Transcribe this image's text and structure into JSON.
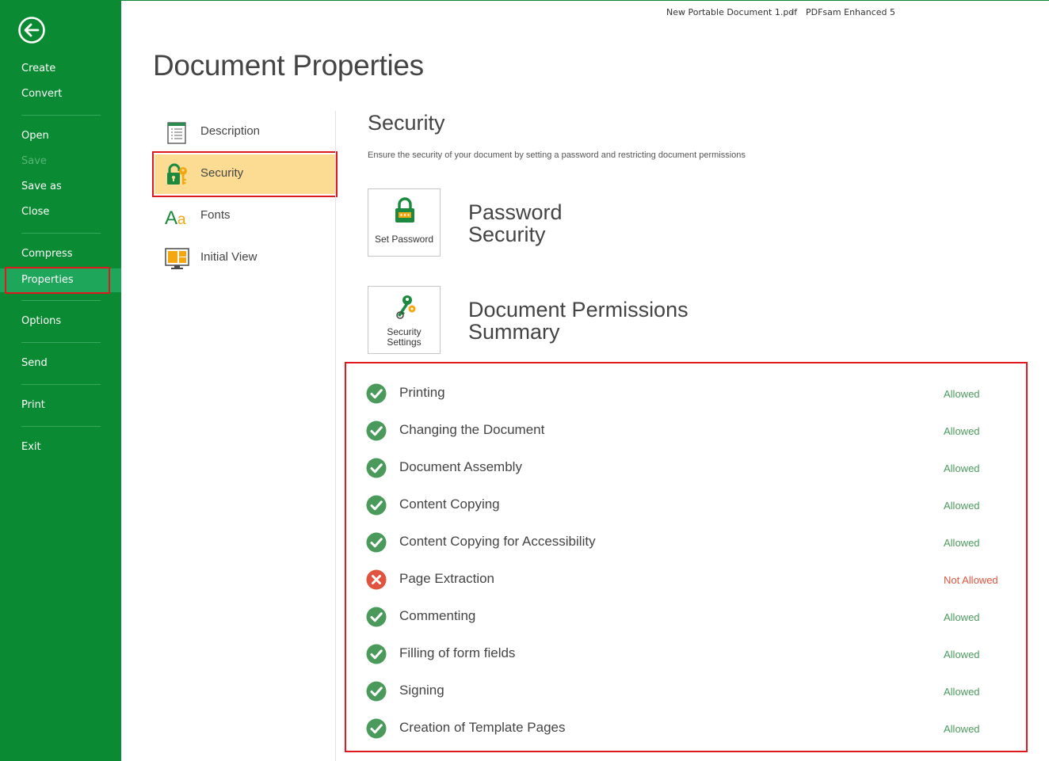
{
  "titlebar": {
    "document": "New Portable Document 1.pdf",
    "separator": "-",
    "app": "PDFsam Enhanced 5"
  },
  "sidebar": {
    "items": [
      {
        "label": "Create"
      },
      {
        "label": "Convert"
      },
      {
        "label": "Open"
      },
      {
        "label": "Save",
        "disabled": true
      },
      {
        "label": "Save as"
      },
      {
        "label": "Close"
      },
      {
        "label": "Compress"
      },
      {
        "label": "Properties",
        "active": true
      },
      {
        "label": "Options"
      },
      {
        "label": "Send"
      },
      {
        "label": "Print"
      },
      {
        "label": "Exit"
      }
    ]
  },
  "page_title": "Document Properties",
  "categories": [
    {
      "label": "Description",
      "icon": "description-icon"
    },
    {
      "label": "Security",
      "icon": "security-lock-key-icon",
      "selected": true
    },
    {
      "label": "Fonts",
      "icon": "fonts-icon"
    },
    {
      "label": "Initial View",
      "icon": "initial-view-icon"
    }
  ],
  "security": {
    "heading": "Security",
    "description": "Ensure the security of your document by setting a password and restricting document permissions",
    "set_password_label": "Set Password",
    "password_heading_line1": "Password",
    "password_heading_line2": "Security",
    "settings_label_line1": "Security",
    "settings_label_line2": "Settings",
    "permissions_heading_line1": "Document Permissions",
    "permissions_heading_line2": "Summary"
  },
  "permissions": [
    {
      "name": "Printing",
      "status": "Allowed",
      "allowed": true
    },
    {
      "name": "Changing the Document",
      "status": "Allowed",
      "allowed": true
    },
    {
      "name": "Document Assembly",
      "status": "Allowed",
      "allowed": true
    },
    {
      "name": "Content Copying",
      "status": "Allowed",
      "allowed": true
    },
    {
      "name": "Content Copying for Accessibility",
      "status": "Allowed",
      "allowed": true
    },
    {
      "name": "Page Extraction",
      "status": "Not Allowed",
      "allowed": false
    },
    {
      "name": "Commenting",
      "status": "Allowed",
      "allowed": true
    },
    {
      "name": "Filling of form fields",
      "status": "Allowed",
      "allowed": true
    },
    {
      "name": "Signing",
      "status": "Allowed",
      "allowed": true
    },
    {
      "name": "Creation of Template Pages",
      "status": "Allowed",
      "allowed": true
    }
  ],
  "colors": {
    "sidebar_bg": "#0a8a32",
    "allowed": "#4a9a5c",
    "not_allowed": "#e0533e",
    "selected_category": "#fcdc93",
    "highlight_border": "#e0191e"
  }
}
